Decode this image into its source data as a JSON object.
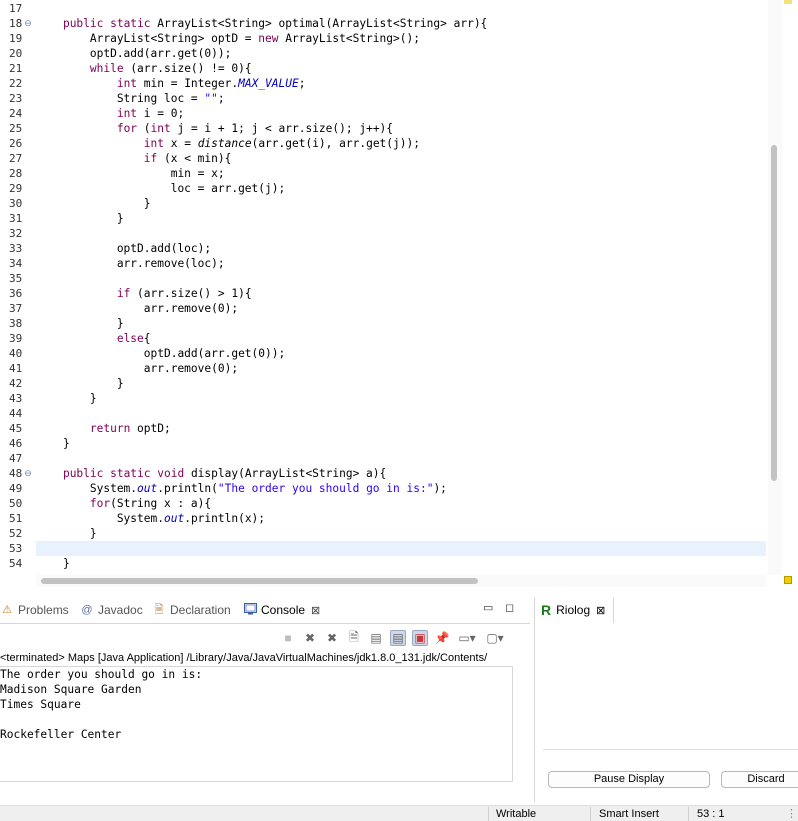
{
  "editor": {
    "first_line": 17,
    "current_line": 53,
    "fold_lines": [
      18,
      48
    ],
    "lines": [
      [],
      [
        {
          "t": "    "
        },
        {
          "t": "public static",
          "c": "kw"
        },
        {
          "t": " ArrayList<String> optimal(ArrayList<String> arr){"
        }
      ],
      [
        {
          "t": "        ArrayList<String> optD = "
        },
        {
          "t": "new",
          "c": "kw"
        },
        {
          "t": " ArrayList<String>();"
        }
      ],
      [
        {
          "t": "        optD.add(arr.get(0));"
        }
      ],
      [
        {
          "t": "        "
        },
        {
          "t": "while",
          "c": "kw"
        },
        {
          "t": " (arr.size() != 0){"
        }
      ],
      [
        {
          "t": "            "
        },
        {
          "t": "int",
          "c": "kw"
        },
        {
          "t": " min = Integer."
        },
        {
          "t": "MAX_VALUE",
          "c": "fld"
        },
        {
          "t": ";"
        }
      ],
      [
        {
          "t": "            String loc = "
        },
        {
          "t": "\"\"",
          "c": "str"
        },
        {
          "t": ";"
        }
      ],
      [
        {
          "t": "            "
        },
        {
          "t": "int",
          "c": "kw"
        },
        {
          "t": " i = 0;"
        }
      ],
      [
        {
          "t": "            "
        },
        {
          "t": "for",
          "c": "kw"
        },
        {
          "t": " ("
        },
        {
          "t": "int",
          "c": "kw"
        },
        {
          "t": " j = i + 1; j < arr.size(); j++){"
        }
      ],
      [
        {
          "t": "                "
        },
        {
          "t": "int",
          "c": "kw"
        },
        {
          "t": " x = "
        },
        {
          "t": "distance",
          "c": "mth"
        },
        {
          "t": "(arr.get(i), arr.get(j));"
        }
      ],
      [
        {
          "t": "                "
        },
        {
          "t": "if",
          "c": "kw"
        },
        {
          "t": " (x < min){"
        }
      ],
      [
        {
          "t": "                    min = x;"
        }
      ],
      [
        {
          "t": "                    loc = arr.get(j);"
        }
      ],
      [
        {
          "t": "                }"
        }
      ],
      [
        {
          "t": "            }"
        }
      ],
      [],
      [
        {
          "t": "            optD.add(loc);"
        }
      ],
      [
        {
          "t": "            arr.remove(loc);"
        }
      ],
      [],
      [
        {
          "t": "            "
        },
        {
          "t": "if",
          "c": "kw"
        },
        {
          "t": " (arr.size() > 1){"
        }
      ],
      [
        {
          "t": "                arr.remove(0);"
        }
      ],
      [
        {
          "t": "            }"
        }
      ],
      [
        {
          "t": "            "
        },
        {
          "t": "else",
          "c": "kw"
        },
        {
          "t": "{"
        }
      ],
      [
        {
          "t": "                optD.add(arr.get(0));"
        }
      ],
      [
        {
          "t": "                arr.remove(0);"
        }
      ],
      [
        {
          "t": "            }"
        }
      ],
      [
        {
          "t": "        }"
        }
      ],
      [],
      [
        {
          "t": "        "
        },
        {
          "t": "return",
          "c": "kw"
        },
        {
          "t": " optD;"
        }
      ],
      [
        {
          "t": "    }"
        }
      ],
      [],
      [
        {
          "t": "    "
        },
        {
          "t": "public static void",
          "c": "kw"
        },
        {
          "t": " display(ArrayList<String> a){"
        }
      ],
      [
        {
          "t": "        System."
        },
        {
          "t": "out",
          "c": "fld"
        },
        {
          "t": ".println("
        },
        {
          "t": "\"The order you should go in is:\"",
          "c": "str"
        },
        {
          "t": ");"
        }
      ],
      [
        {
          "t": "        "
        },
        {
          "t": "for",
          "c": "kw"
        },
        {
          "t": "(String x : a){"
        }
      ],
      [
        {
          "t": "            System."
        },
        {
          "t": "out",
          "c": "fld"
        },
        {
          "t": ".println(x);"
        }
      ],
      [
        {
          "t": "        }"
        }
      ],
      [],
      [
        {
          "t": "    }"
        }
      ]
    ]
  },
  "panel": {
    "tabs": {
      "problems": "Problems",
      "javadoc": "Javadoc",
      "declaration": "Declaration",
      "console": "Console"
    },
    "console": {
      "status": "<terminated> Maps [Java Application] /Library/Java/JavaVirtualMachines/jdk1.8.0_131.jdk/Contents/",
      "output": [
        "The order you should go in is:",
        "Madison Square Garden",
        "Times Square",
        "",
        "Rockefeller Center"
      ]
    }
  },
  "riolog": {
    "tab_label": "Riolog",
    "pause_button": "Pause Display",
    "discard_button": "Discard"
  },
  "statusbar": {
    "writable": "Writable",
    "insert_mode": "Smart Insert",
    "position": "53 : 1"
  }
}
